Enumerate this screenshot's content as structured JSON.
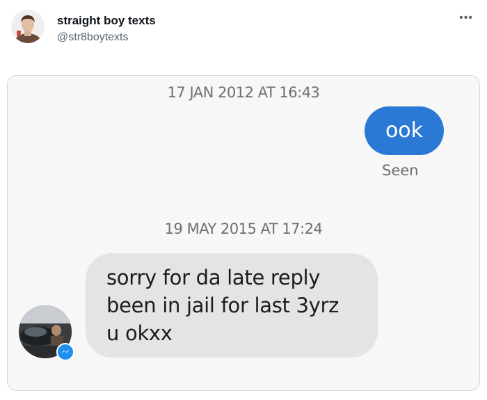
{
  "tweet": {
    "display_name": "straight boy texts",
    "handle": "@str8boytexts",
    "more_icon": "more-horizontal-icon"
  },
  "chat": {
    "timestamp_1": "17 JAN 2012 AT 16:43",
    "sent_message": "ook",
    "seen_label": "Seen",
    "timestamp_2": "19 MAY 2015 AT 17:24",
    "received_lines": [
      "sorry for da late reply",
      "been in jail for last 3yrz",
      "u okxx"
    ],
    "sent_bubble_color": "#2a79d5",
    "received_bubble_color": "#e4e4e4",
    "badge_icon": "messenger-icon"
  }
}
